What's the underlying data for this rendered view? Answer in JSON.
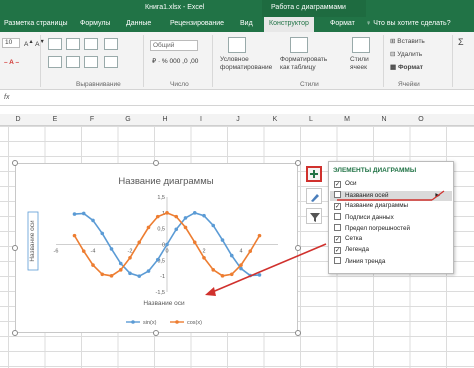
{
  "window": {
    "doc_title": "Книга1.xlsx - Excel",
    "context_title": "Работа с диаграммами"
  },
  "tabs": [
    "Разметка страницы",
    "Формулы",
    "Данные",
    "Рецензирование",
    "Вид",
    "Конструктор",
    "Формат"
  ],
  "search_hint": "Что вы хотите сделать?",
  "ribbon": {
    "font_size": "10",
    "number_format": "Общий",
    "cond_format": [
      "Условное",
      "форматирование"
    ],
    "format_table": [
      "Форматировать",
      "как таблицу"
    ],
    "cell_styles": [
      "Стили",
      "ячеек"
    ],
    "insert": "Вставить",
    "delete": "Удалить",
    "format": "Формат",
    "groups": {
      "alignment": "Выравнивание",
      "number": "Число",
      "styles": "Стили",
      "cells": "Ячейки"
    }
  },
  "formula_bar": {
    "fx": "fx"
  },
  "columns": [
    "D",
    "E",
    "F",
    "G",
    "H",
    "I",
    "J",
    "K",
    "L",
    "M",
    "N",
    "O"
  ],
  "chart_data": {
    "type": "line",
    "title": "Название диаграммы",
    "xlabel": "Название оси",
    "ylabel": "Название оси",
    "x": [
      -5,
      -4.5,
      -4,
      -3.5,
      -3,
      -2.5,
      -2,
      -1.5,
      -1,
      -0.5,
      0,
      0.5,
      1,
      1.5,
      2,
      2.5,
      3,
      3.5,
      4,
      4.5,
      5
    ],
    "series": [
      {
        "name": "sin(x)",
        "color": "#5b9bd5",
        "values": [
          0.96,
          0.98,
          0.76,
          0.35,
          -0.14,
          -0.6,
          -0.91,
          -1.0,
          -0.84,
          -0.48,
          0.0,
          0.48,
          0.84,
          1.0,
          0.91,
          0.6,
          0.14,
          -0.35,
          -0.76,
          -0.98,
          -0.96
        ]
      },
      {
        "name": "cos(x)",
        "color": "#ed7d31",
        "values": [
          0.28,
          -0.21,
          -0.65,
          -0.94,
          -0.99,
          -0.8,
          -0.42,
          0.07,
          0.54,
          0.88,
          1.0,
          0.88,
          0.54,
          0.07,
          -0.42,
          -0.8,
          -0.99,
          -0.94,
          -0.65,
          -0.21,
          0.28
        ]
      }
    ],
    "x_ticks": [
      "-6",
      "-4",
      "-2",
      "0",
      "2",
      "4"
    ],
    "y_ticks": [
      "1,5",
      "1",
      "0,5",
      "0",
      "-0,5",
      "-1",
      "-1,5"
    ],
    "ylim": [
      -1.5,
      1.5
    ],
    "xlim": [
      -6,
      6
    ],
    "legend_position": "bottom"
  },
  "panel": {
    "title": "ЭЛЕМЕНТЫ ДИАГРАММЫ",
    "items": [
      {
        "label": "Оси",
        "checked": true
      },
      {
        "label": "Названия осей",
        "checked": false
      },
      {
        "label": "Название диаграммы",
        "checked": true
      },
      {
        "label": "Подписи данных",
        "checked": false
      },
      {
        "label": "Предел погрешностей",
        "checked": false
      },
      {
        "label": "Сетка",
        "checked": true
      },
      {
        "label": "Легенда",
        "checked": true
      },
      {
        "label": "Линия тренда",
        "checked": false
      }
    ]
  },
  "colors": {
    "excel_green": "#217346",
    "annotation_red": "#d0312d"
  }
}
